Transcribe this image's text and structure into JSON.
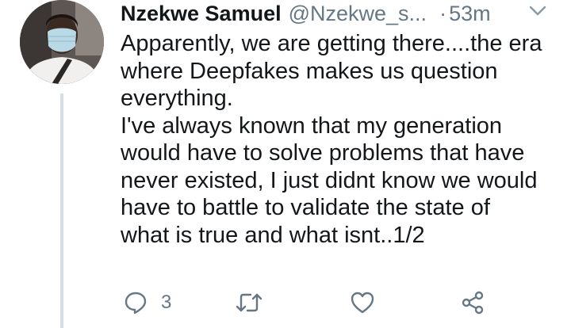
{
  "tweet": {
    "display_name": "Nzekwe Samuel",
    "handle": "@Nzekwe_s...",
    "separator": "·",
    "time": "53m",
    "text_lines": [
      "Apparently, we are getting there....the era",
      "where Deepfakes makes us question",
      "everything.",
      "I've always known that my generation",
      "would have to solve problems that have",
      "never existed, I just didnt know we would",
      "have to battle to validate the state of",
      "what is true and what isnt..1/2"
    ],
    "reply_count": "3"
  },
  "icons": {
    "caret": "chevron-down-icon",
    "reply": "reply-bubble-icon",
    "retweet": "retweet-icon",
    "like": "heart-icon",
    "share": "share-icon"
  },
  "colors": {
    "text": "#14171a",
    "secondary": "#657786",
    "thread_line": "#d7dde3",
    "background": "#ffffff"
  }
}
